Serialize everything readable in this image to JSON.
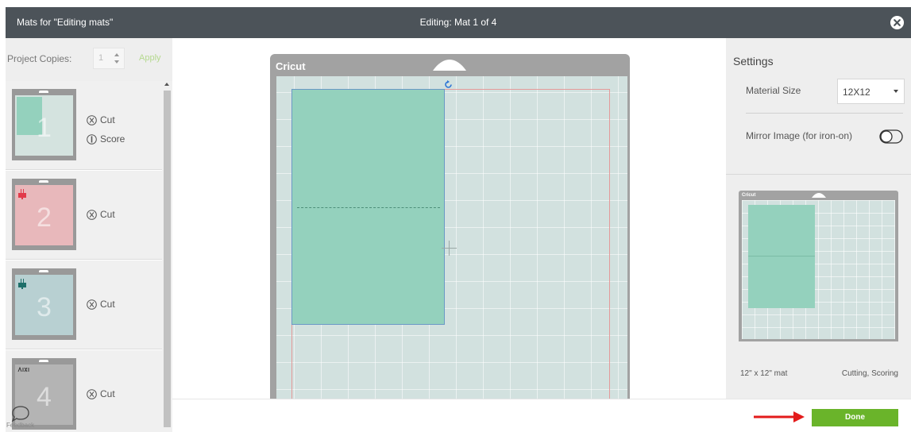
{
  "header": {
    "title": "Mats for \"Editing mats\"",
    "center_title": "Editing: Mat 1 of 4",
    "close_icon": "close-circle-icon"
  },
  "left_panel": {
    "project_copies_label": "Project Copies:",
    "project_copies_value": "1",
    "apply_label": "Apply",
    "mats": [
      {
        "number": "1",
        "thumb_color": "#d4e3df",
        "ops": [
          "Cut",
          "Score"
        ]
      },
      {
        "number": "2",
        "thumb_color": "#e8b8bb",
        "ops": [
          "Cut"
        ]
      },
      {
        "number": "3",
        "thumb_color": "#b8d0d2",
        "ops": [
          "Cut"
        ]
      },
      {
        "number": "4",
        "thumb_color": "#b4b4b4",
        "ops": [
          "Cut"
        ]
      }
    ],
    "feedback_label": "Feedback"
  },
  "canvas": {
    "logo": "Cricut",
    "design_color": "#94d1bd"
  },
  "settings": {
    "title": "Settings",
    "material_size_label": "Material Size",
    "material_size_value": "12X12",
    "mirror_label": "Mirror Image (for iron-on)",
    "mirror_on": false
  },
  "preview": {
    "logo": "Cricut",
    "size_label": "12\" x 12\" mat",
    "ops_label": "Cutting, Scoring"
  },
  "footer": {
    "done_label": "Done",
    "done_color": "#6ab42a",
    "arrow_color": "#e31b1b"
  }
}
